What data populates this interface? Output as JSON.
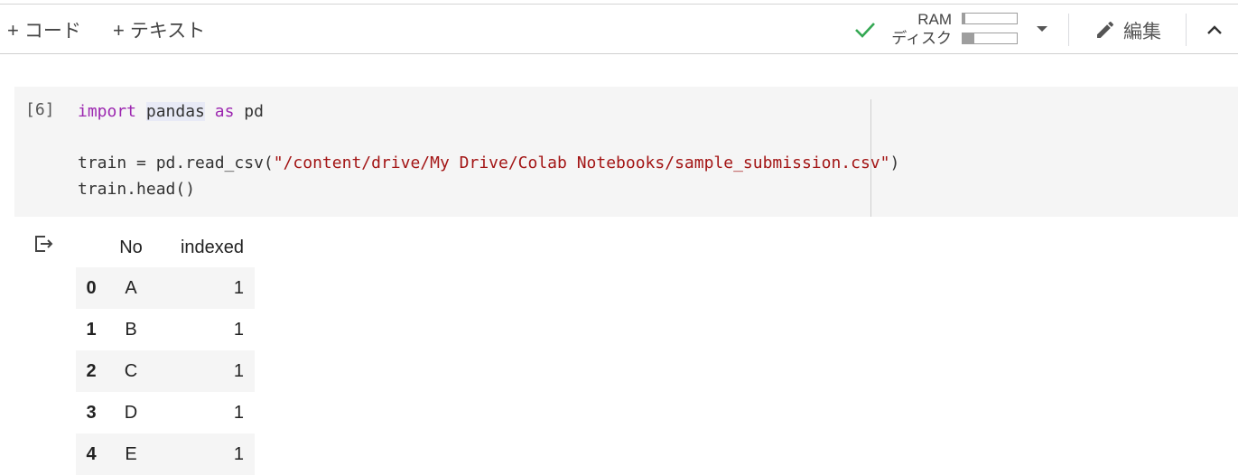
{
  "toolbar": {
    "add_code_label": "コード",
    "add_text_label": "テキスト",
    "resources": {
      "ram_label": "RAM",
      "disk_label": "ディスク",
      "ram_usage": 0.05,
      "disk_usage": 0.22
    },
    "edit_label": "編集",
    "icons": [
      "plus-icon",
      "check-icon",
      "dropdown-icon",
      "pencil-icon",
      "chevron-up-icon"
    ],
    "connected_color": "#34a853"
  },
  "cell": {
    "execution_count": "[6]",
    "code": {
      "line1_kw_import": "import",
      "line1_module": "pandas",
      "line1_kw_as": "as",
      "line1_alias": "pd",
      "line2_prefix": "train = pd.read_csv(",
      "line2_string": "\"/content/drive/My Drive/Colab Notebooks/sample_submission.csv\"",
      "line2_suffix": ")",
      "line3": "train.head()"
    }
  },
  "output": {
    "icon": "output-arrow-icon",
    "columns": [
      "",
      "No",
      "indexed"
    ],
    "rows": [
      {
        "index": "0",
        "No": "A",
        "indexed": "1"
      },
      {
        "index": "1",
        "No": "B",
        "indexed": "1"
      },
      {
        "index": "2",
        "No": "C",
        "indexed": "1"
      },
      {
        "index": "3",
        "No": "D",
        "indexed": "1"
      },
      {
        "index": "4",
        "No": "E",
        "indexed": "1"
      }
    ]
  }
}
